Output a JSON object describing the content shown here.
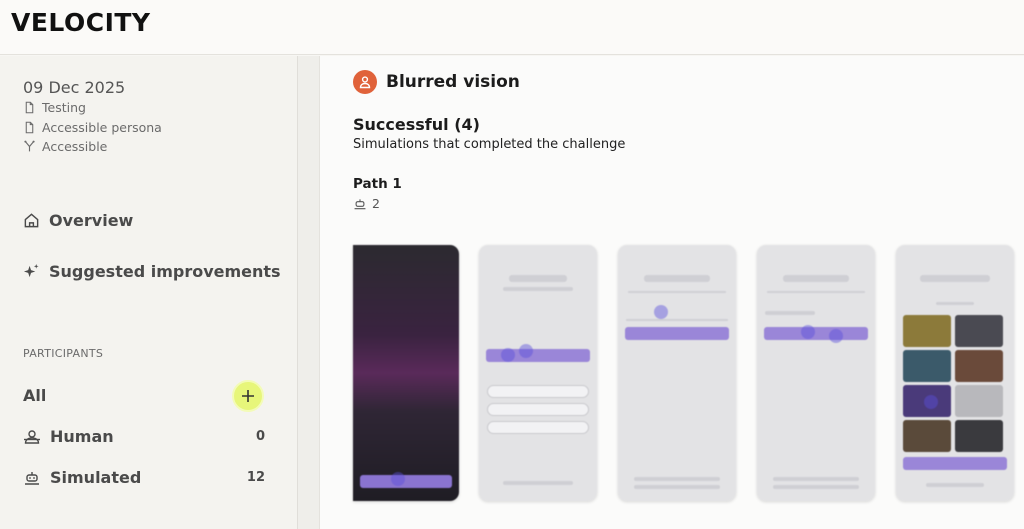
{
  "app": {
    "title": "VELOCITY"
  },
  "sidebar": {
    "date": "09 Dec 2025",
    "meta": [
      {
        "label": "Testing",
        "icon": "document-icon"
      },
      {
        "label": "Accessible persona",
        "icon": "document-icon"
      },
      {
        "label": "Accessible",
        "icon": "branch-icon"
      }
    ],
    "nav": [
      {
        "label": "Overview",
        "icon": "home-icon"
      },
      {
        "label": "Suggested improvements",
        "icon": "sparkle-icon"
      }
    ],
    "participants_heading": "PARTICIPANTS",
    "all_label": "All",
    "add_icon": "plus-icon",
    "participants": [
      {
        "label": "Human",
        "count": "0",
        "icon": "people-icon"
      },
      {
        "label": "Simulated",
        "count": "12",
        "icon": "robot-icon"
      }
    ]
  },
  "main": {
    "persona_title": "Blurred vision",
    "persona_icon": "person-icon",
    "persona_color": "#e0623a",
    "success_title": "Successful (4)",
    "success_sub": "Simulations that completed the challenge",
    "path_title": "Path 1",
    "path_count": "2",
    "accent_color": "#e7f67a"
  }
}
